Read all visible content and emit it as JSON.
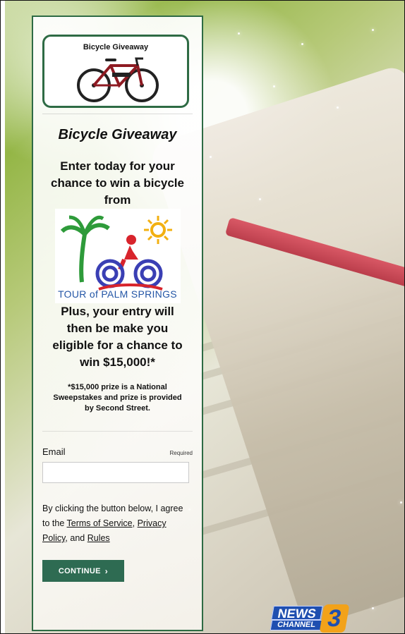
{
  "logo_card": {
    "text": "Bicycle Giveaway",
    "icon": "bicycle-icon"
  },
  "title": "Bicycle Giveaway",
  "lead_lines": [
    "Enter today for your",
    "chance to win a bicycle",
    "from"
  ],
  "sponsor_logo": {
    "text": "Tour of Palm Springs",
    "display_text": "TOUR of PALM SPRINGS",
    "icons": [
      "palm-tree-icon",
      "sun-icon",
      "cyclist-icon"
    ]
  },
  "plus_lines": [
    "Plus, your entry will",
    "then be make you",
    "eligible for a chance to",
    "win $15,000!*"
  ],
  "fine_print_lines": [
    "*$15,000 prize is a National",
    "Sweepstakes and prize is provided",
    "by Second Street."
  ],
  "email": {
    "label": "Email",
    "required_label": "Required",
    "value": "",
    "placeholder": ""
  },
  "terms": {
    "prefix": "By clicking the button below, I agree to the",
    "tos": "Terms of Service",
    "comma": ",",
    "privacy": "Privacy Policy",
    "and": ", and",
    "rules": "Rules"
  },
  "continue_button": {
    "label": "CONTINUE",
    "icon": "chevron-right-icon"
  },
  "footer_logo": {
    "news": "NEWS",
    "channel": "CHANNEL",
    "number": "3"
  },
  "colors": {
    "accent": "#2e6b44",
    "button": "#2e6b52",
    "news_blue": "#1f4fb0",
    "news_orange": "#f2a21a"
  }
}
